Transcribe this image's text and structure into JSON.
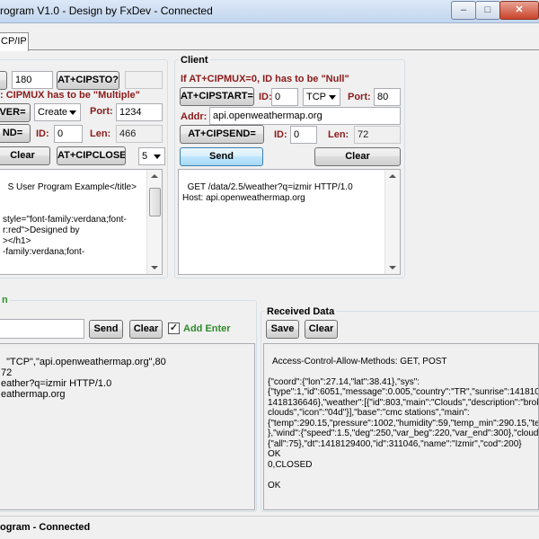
{
  "window": {
    "title": "rogram V1.0 - Design by FxDev - Connected",
    "buttons": {
      "minimize": "–",
      "maximize": "□",
      "close": "✕"
    }
  },
  "tabs": [
    {
      "label": "CP/IP"
    }
  ],
  "server": {
    "timeout_btn_partial": "",
    "timeout_value": "180",
    "cipsto_button": "AT+CIPSTO?",
    "cipsto_result": "",
    "mux_note": ": CIPMUX has to be \"Multiple\"",
    "server_btn_partial": "VER=",
    "mode_select": "Create",
    "port_label": "Port:",
    "port_value": "1234",
    "send_btn_partial": "ND=",
    "id_label": "ID:",
    "id_value": "0",
    "len_label": "Len:",
    "len_value": "466",
    "clear_button": "Clear",
    "cipclose_button": "AT+CIPCLOSE=",
    "close_id_select": "5",
    "memo_text": "S User Program Example</title>\n\n\nstyle=\"font-family:verdana;font-\nr:red\">Designed by\n></h1>\n-family:verdana;font-"
  },
  "client": {
    "group_title": "Client",
    "mux_note": "If AT+CIPMUX=0, ID has to be \"Null\"",
    "cipstart_button": "AT+CIPSTART=",
    "id_label": "ID:",
    "id_value": "0",
    "protocol_select": "TCP",
    "port_label": "Port:",
    "port_value": "80",
    "addr_label": "Addr:",
    "addr_value": "api.openweathermap.org",
    "cipsend_button": "AT+CIPSEND=",
    "send_id_label": "ID:",
    "send_id_value": "0",
    "len_label": "Len:",
    "len_value": "72",
    "send_button": "Send",
    "clear_button": "Clear",
    "memo_text": "GET /data/2.5/weather?q=izmir HTTP/1.0\nHost: api.openweathermap.org"
  },
  "terminal": {
    "group_title_partial": "n",
    "command_value": "",
    "send_button": "Send",
    "clear_button": "Clear",
    "add_enter_label": "Add Enter",
    "add_enter_checked": "✓",
    "log_text": "\"TCP\",\"api.openweathermap.org\",80\n72\neather?q=izmir HTTP/1.0\neathermap.org"
  },
  "received": {
    "group_title": "Received Data",
    "save_button": "Save",
    "clear_button": "Clear",
    "text": "Access-Control-Allow-Methods: GET, POST\n\n{\"coord\":{\"lon\":27.14,\"lat\":38.41},\"sys\":\n{\"type\":1,\"id\":6051,\"message\":0.005,\"country\":\"TR\",\"sunrise\":141810222\n1418136646},\"weather\":[{\"id\":803,\"main\":\"Clouds\",\"description\":\"broken\nclouds\",\"icon\":\"04d\"}],\"base\":\"cmc stations\",\"main\":\n{\"temp\":290.15,\"pressure\":1002,\"humidity\":59,\"temp_min\":290.15,\"temp_\n},\"wind\":{\"speed\":1.5,\"deg\":250,\"var_beg\":220,\"var_end\":300},\"clouds\":\n{\"all\":75},\"dt\":1418129400,\"id\":311046,\"name\":\"Izmir\",\"cod\":200}\nOK\n0,CLOSED\n\nOK"
  },
  "status": {
    "text": "ogram - Connected"
  },
  "colors": {
    "label_red": "#8b1a1a",
    "add_enter_green": "#2e8b2e",
    "title_gradient_top": "#dbe8f7"
  }
}
